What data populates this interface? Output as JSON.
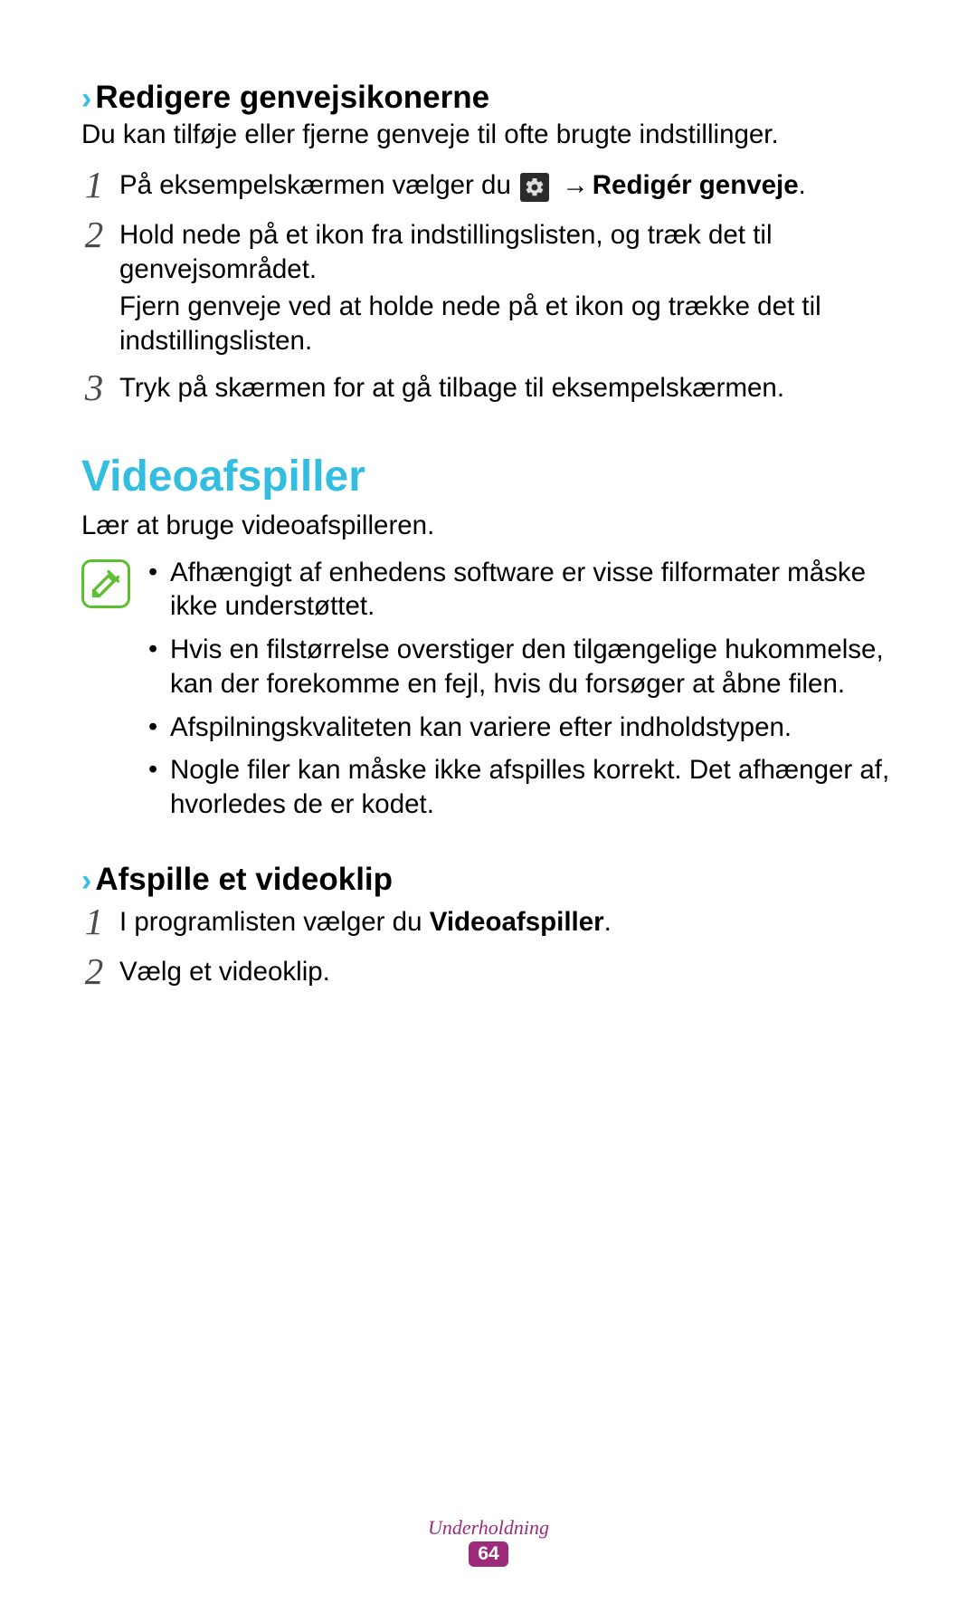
{
  "section1": {
    "heading": "Redigere genvejsikonerne",
    "intro": "Du kan tilføje eller fjerne genveje til ofte brugte indstillinger.",
    "steps": {
      "s1_prefix": "På eksempelskærmen vælger du ",
      "s1_bold": "Redigér genveje",
      "s1_suffix": ".",
      "s2_a": "Hold nede på et ikon fra indstillingslisten, og træk det til genvejsområdet.",
      "s2_b": "Fjern genveje ved at holde nede på et ikon og trække det til indstillingslisten.",
      "s3": "Tryk på skærmen for at gå tilbage til eksempelskærmen."
    }
  },
  "main": {
    "heading": "Videoafspiller",
    "intro": "Lær at bruge videoafspilleren.",
    "bullets": {
      "b1": "Afhængigt af enhedens software er visse filformater måske ikke understøttet.",
      "b2": "Hvis en filstørrelse overstiger den tilgængelige hukommelse, kan der forekomme en fejl, hvis du forsøger at åbne filen.",
      "b3": "Afspilningskvaliteten kan variere efter indholdstypen.",
      "b4": "Nogle filer kan måske ikke afspilles korrekt. Det afhænger af, hvorledes de er kodet."
    }
  },
  "section2": {
    "heading": "Afspille et videoklip",
    "steps": {
      "s1_prefix": "I programlisten vælger du ",
      "s1_bold": "Videoafspiller",
      "s1_suffix": ".",
      "s2": "Vælg et videoklip."
    }
  },
  "nums": {
    "n1": "1",
    "n2": "2",
    "n3": "3"
  },
  "arrow": "→",
  "footer": {
    "label": "Underholdning",
    "page": "64"
  }
}
